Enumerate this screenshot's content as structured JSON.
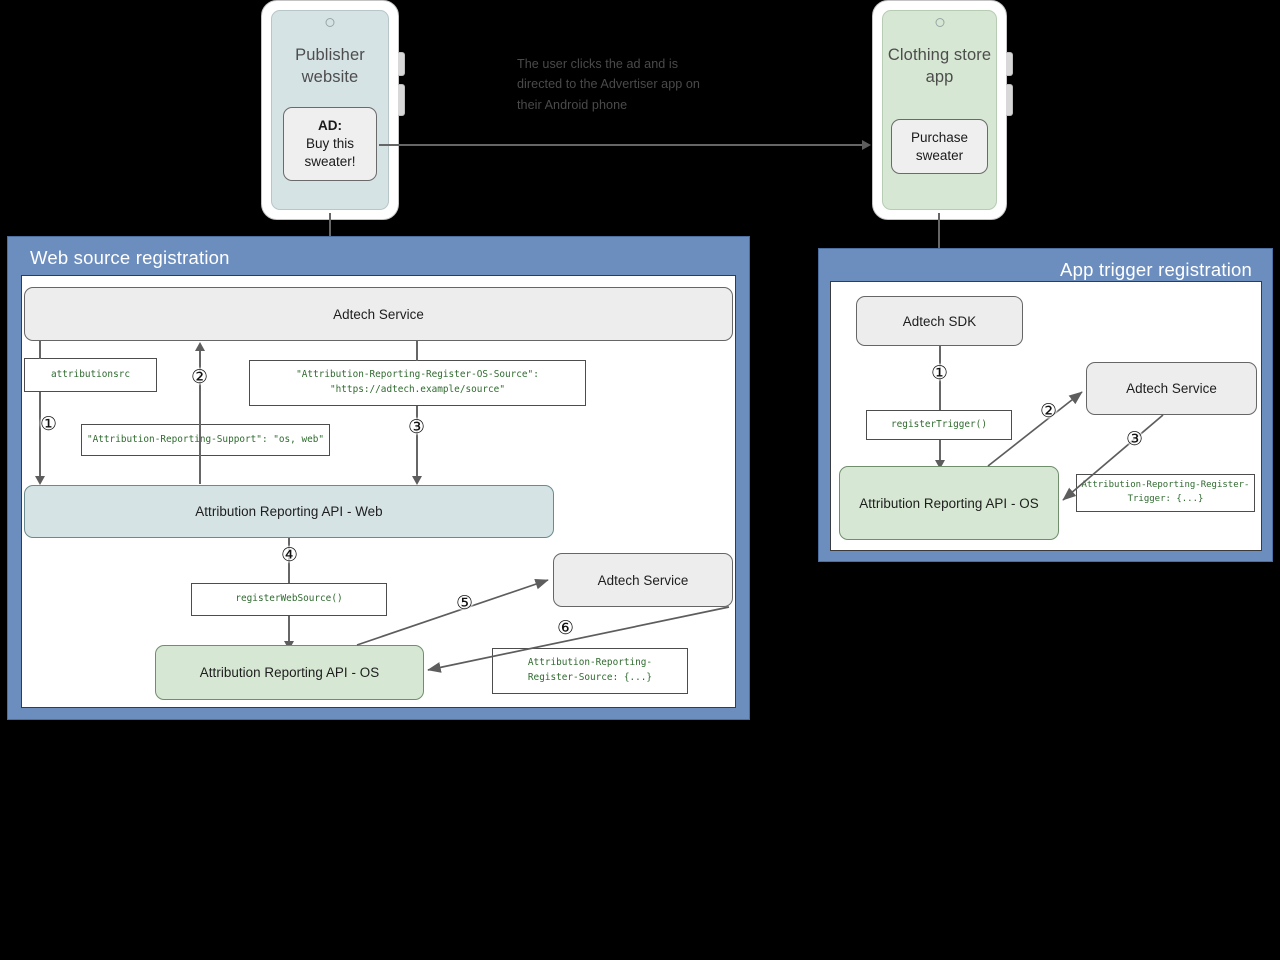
{
  "theme": {
    "panel_blue": "#6c8ebf",
    "node_grey": "#ededed",
    "node_blue": "#d6e3e5",
    "node_green": "#d6e8d3",
    "code_green": "#2f6b2f",
    "connector_grey": "#666666",
    "background": "#000000"
  },
  "phones": {
    "publisher": {
      "title": "Publisher\nwebsite",
      "title_line1": "Publisher",
      "title_line2": "website",
      "card_heading": "AD:",
      "card_line1": "Buy this",
      "card_line2": "sweater!"
    },
    "advertiser": {
      "title_line1": "Clothing store",
      "title_line2": "app",
      "card_line1": "Purchase",
      "card_line2": "sweater"
    }
  },
  "caption": {
    "line1": "The user clicks the ad and is",
    "line2": "directed to the Advertiser app on",
    "line3": "their Android phone"
  },
  "web_panel": {
    "title": "Web source registration",
    "nodes": {
      "adtech_service_top": "Adtech Service",
      "api_web": "Attribution Reporting API - Web",
      "adtech_service_bottom": "Adtech Service",
      "api_os": "Attribution Reporting API - OS"
    },
    "boxes": {
      "attributionsrc": "attributionsrc",
      "register_os_source": "\"Attribution-Reporting-Register-OS-Source\":\n        \"https://adtech.example/source\"",
      "support": "\"Attribution-Reporting-Support\": \"os, web\"",
      "register_web_source": "registerWebSource()",
      "register_source": "Attribution-Reporting-\nRegister-Source: {...}"
    },
    "steps": [
      "①",
      "②",
      "③",
      "④",
      "⑤",
      "⑥"
    ]
  },
  "app_panel": {
    "title": "App trigger registration",
    "nodes": {
      "adtech_sdk": "Adtech SDK",
      "adtech_service": "Adtech Service",
      "api_os": "Attribution Reporting API - OS"
    },
    "boxes": {
      "register_trigger": "registerTrigger()",
      "register_trigger_header": "Attribution-Reporting-Register-\n            Trigger: {...}"
    },
    "steps": [
      "①",
      "②",
      "③"
    ]
  }
}
